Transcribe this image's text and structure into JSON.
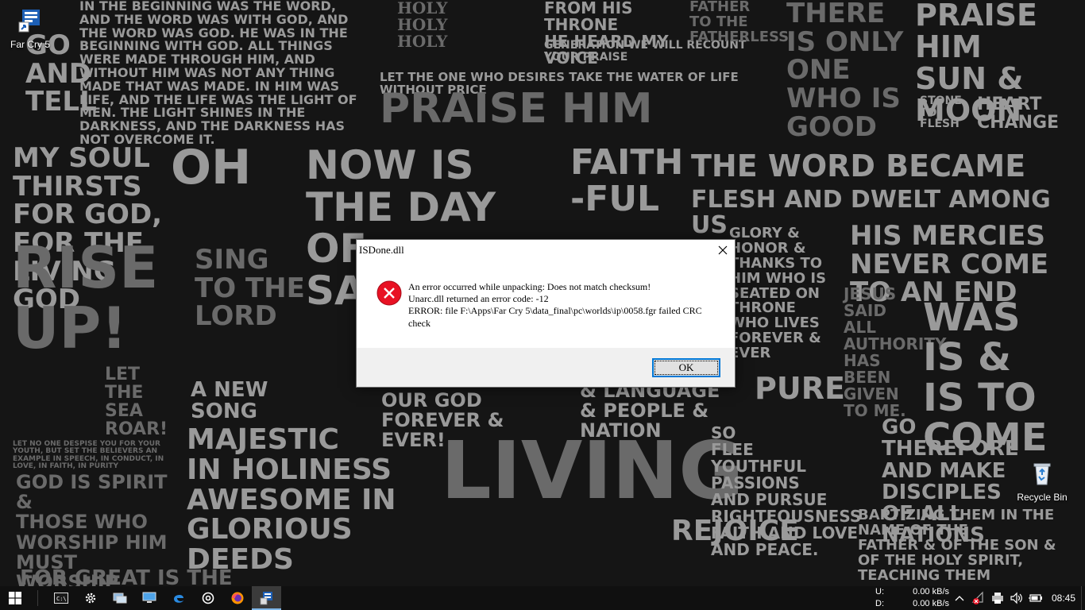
{
  "desktop": {
    "icons": [
      {
        "label": "Far Cry 5",
        "icon": "far-cry-5-shortcut-icon"
      },
      {
        "label": "Recycle Bin",
        "icon": "recycle-bin-icon"
      }
    ],
    "wallpaper_text": [
      "IN THE BEGINNING WAS THE WORD, AND THE WORD WAS WITH GOD, AND THE WORD WAS GOD. HE WAS IN THE BEGINNING WITH GOD. ALL THINGS WERE MADE THROUGH HIM, AND WITHOUT HIM WAS NOT ANY THING MADE THAT WAS MADE. IN HIM WAS LIFE, AND THE LIFE WAS THE LIGHT OF MEN. THE LIGHT SHINES IN THE DARKNESS, AND THE DARKNESS HAS NOT OVERCOME IT.",
      "HOLY\nHOLY\nHOLY",
      "FROM HIS THRONE\nHE HEARD MY VOICE",
      "GENERATION WE WILL RECOUNT YOUR PRAISE",
      "FATHER\nTO THE\nFATHERLESS",
      "there is only\nONE\nwho is good",
      "PRAISE\nHIM\nSUN & MOON",
      "STONE TO\nFLESH",
      "HEART\nCHANGE",
      "LET THE ONE WHO DESIRES TAKE THE WATER OF LIFE WITHOUT PRICE",
      "PRAISE HIM",
      "GO\nAND\nTELL",
      "MY SOUL\nTHIRSTS FOR GOD,\nFOR THE Living\nGOD",
      "OH",
      "NOW IS THE DAY OF\nSALVATION",
      "FAITH\n-FUL",
      "THE WORD BECAME",
      "FLESH AND DWELT AMONG US",
      "HIS MERCIES\nNEVER COME TO AN END",
      "RISE UP!",
      "GLORY &\nHONOR &\nTHANKS TO\nHIM WHO IS\nSEATED ON\nTHRONE\nWHO LIVES\nFOREVER &\nEVER",
      "JESUS\nSAID ALL\nAUTHORITY\nHAS BEEN\nGIVEN\nTO ME.",
      "WAS\nIS &\nIS TO COME",
      "Sing TO THE LORD",
      "A NEW SONG",
      "LET THE SEA\nROAR!",
      "OUR GOD FOREVER & EVER!",
      "& LANGUAGE\n& PEOPLE & NATION",
      "PURE",
      "Let no one despise you for your youth, but set the believers an example in speech, in conduct, in love, in faith, in purity",
      "MAJESTIC\nIN HOLINESS\nAWESOME IN\nGLORIOUS\nDEEDS",
      "LIVING",
      "SO\nFLEE\nYOUTHFUL PASSIONS\nAND PURSUE RIGHTEOUSNESS\nFAITH AND LOVE AND PEACE.",
      "REJOICE",
      "GO\nTHEREFORE AND MAKE\nDISCIPLES\nOF ALL NATIONS",
      "BAPTIZING THEM IN THE NAME OF THE\nFATHER & OF THE SON &\nOF THE HOLY SPIRIT,\nTEACHING THEM",
      "God is spirit &\nTHOSE WHO WORSHIP him\nMUST WORSHIP\nSPIRIT & TRUTH",
      "For great is the Lord"
    ]
  },
  "dialog": {
    "title": "ISDone.dll",
    "icon": "error-icon",
    "lines": [
      "An error occurred while unpacking: Does not match checksum!",
      "Unarc.dll returned an error code: -12",
      "ERROR: file F:\\Apps\\Far Cry 5\\data_final\\pc\\worlds\\ip\\0058.fgr failed CRC check"
    ],
    "ok_label": "OK"
  },
  "taskbar": {
    "pinned": [
      {
        "name": "start-button",
        "icon": "windows-logo-icon"
      },
      {
        "name": "taskbar-terminal",
        "icon": "terminal-icon"
      },
      {
        "name": "taskbar-settings",
        "icon": "gear-icon"
      },
      {
        "name": "taskbar-network-computer",
        "icon": "network-computer-icon"
      },
      {
        "name": "taskbar-this-pc",
        "icon": "monitor-icon"
      },
      {
        "name": "taskbar-edge",
        "icon": "edge-icon"
      },
      {
        "name": "taskbar-groove",
        "icon": "music-disc-icon"
      },
      {
        "name": "taskbar-firefox",
        "icon": "firefox-icon"
      },
      {
        "name": "taskbar-installer",
        "icon": "installer-icon"
      }
    ],
    "net_meter": {
      "upload_label": "U:",
      "upload_value": "0.00 kB/s",
      "download_label": "D:",
      "download_value": "0.00 kB/s"
    },
    "clock": "08:45"
  },
  "colors": {
    "accent": "#0078d7",
    "error_red": "#e81123",
    "taskbar": "#101010",
    "dialog_footer": "#f0f0f0"
  }
}
